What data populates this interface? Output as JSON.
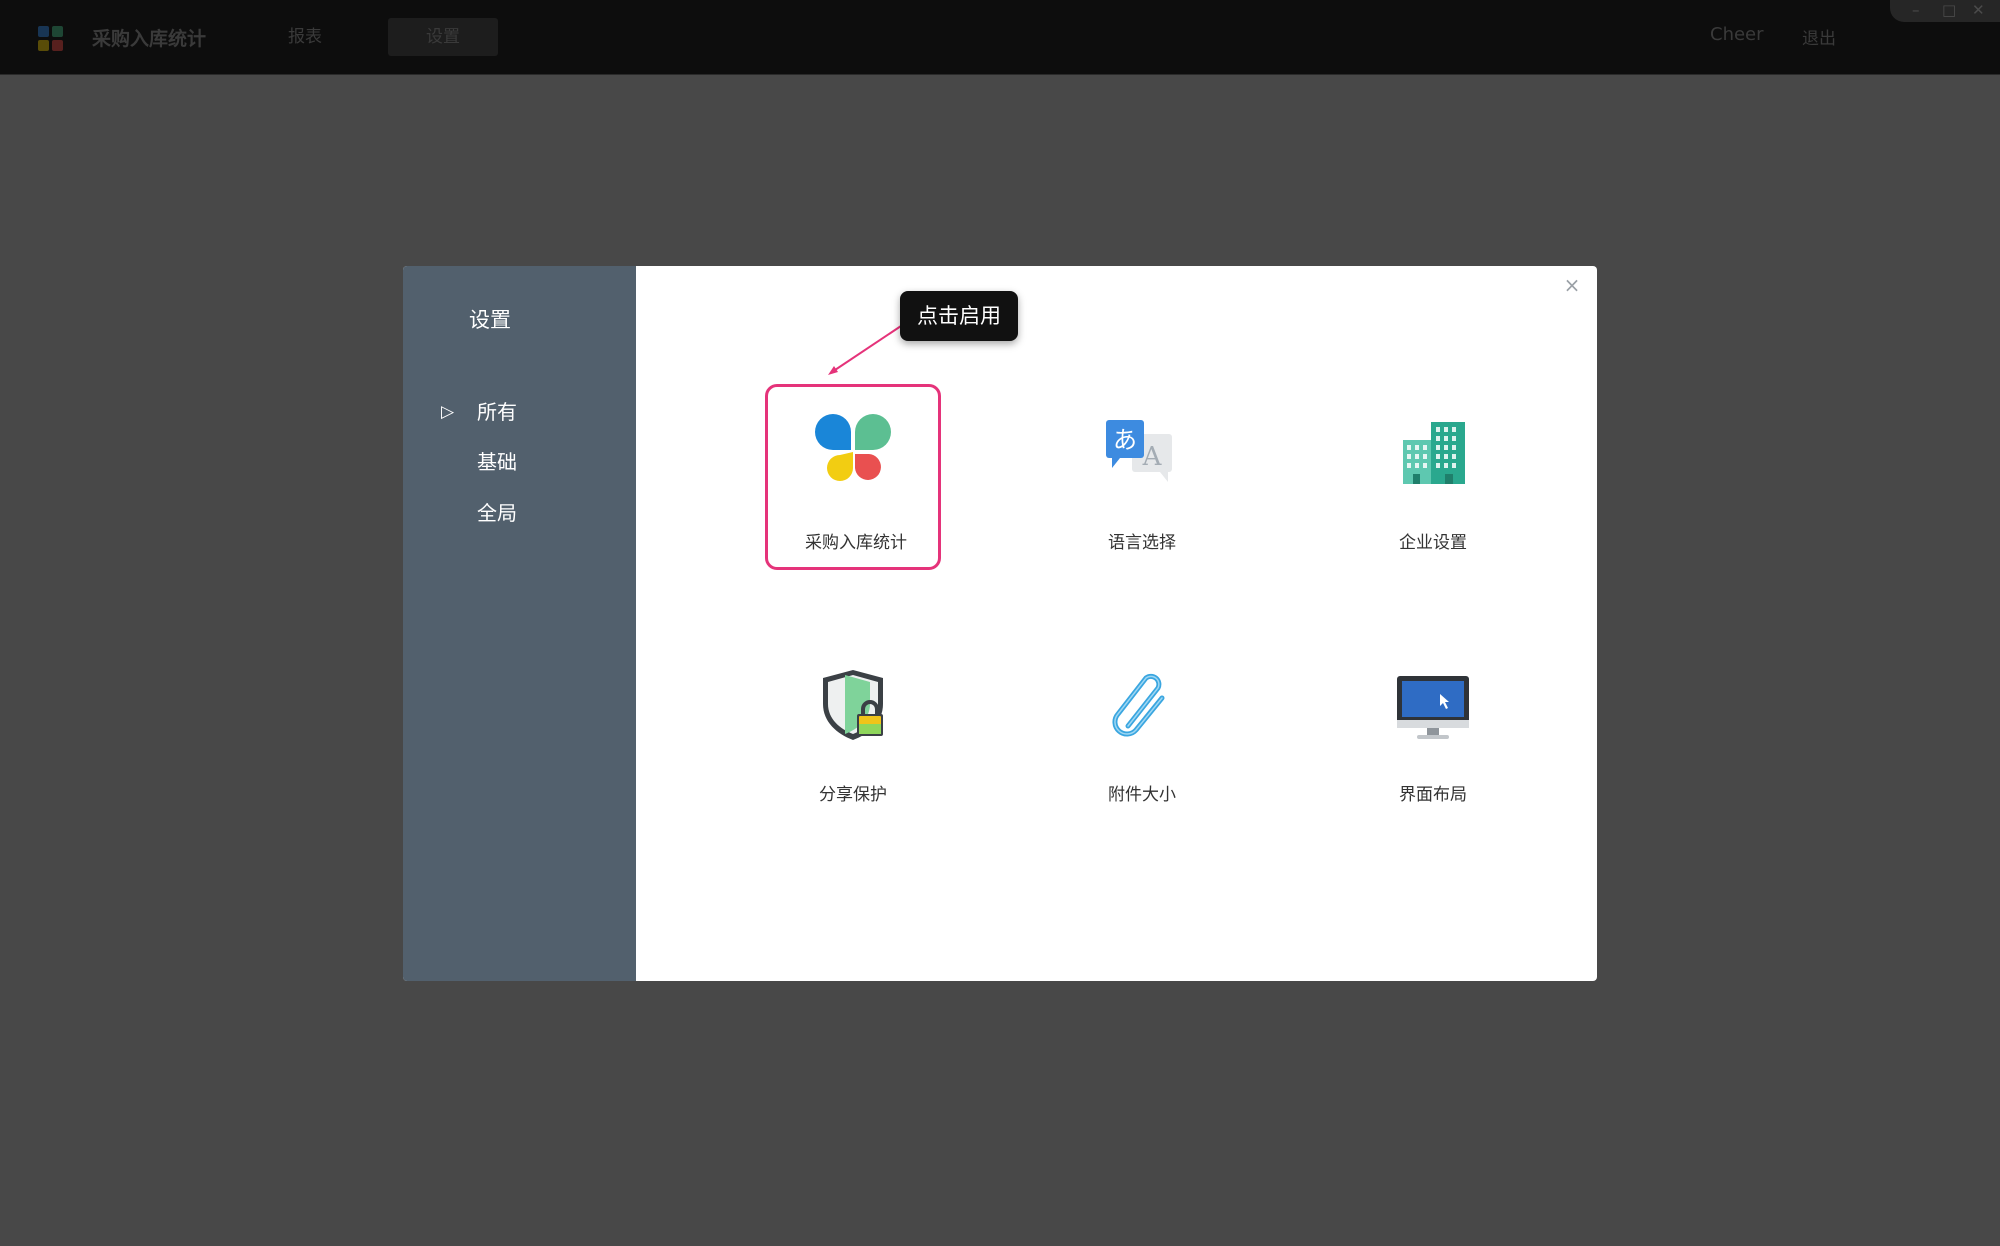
{
  "topbar": {
    "app_title": "采购入库统计",
    "tabs": [
      {
        "label": "报表"
      },
      {
        "label": "设置"
      }
    ],
    "user": "Cheer",
    "logout": "退出",
    "window_controls": {
      "minimize": "–",
      "maximize": "□",
      "close": "✕"
    }
  },
  "dialog": {
    "title": "设置",
    "close_glyph": "×",
    "sidebar": {
      "items": [
        {
          "label": "所有",
          "arrow": "▷"
        },
        {
          "label": "基础"
        },
        {
          "label": "全局"
        }
      ]
    },
    "tiles": [
      {
        "label": "采购入库统计",
        "icon": "app-clover-icon"
      },
      {
        "label": "语言选择",
        "icon": "language-icon"
      },
      {
        "label": "企业设置",
        "icon": "building-icon"
      },
      {
        "label": "分享保护",
        "icon": "shield-lock-icon"
      },
      {
        "label": "附件大小",
        "icon": "paperclip-icon"
      },
      {
        "label": "界面布局",
        "icon": "monitor-icon"
      }
    ],
    "callout": "点击启用"
  },
  "colors": {
    "highlight": "#e5337a",
    "sidebar_bg": "#52606d",
    "overlay_bg": "#484848"
  }
}
